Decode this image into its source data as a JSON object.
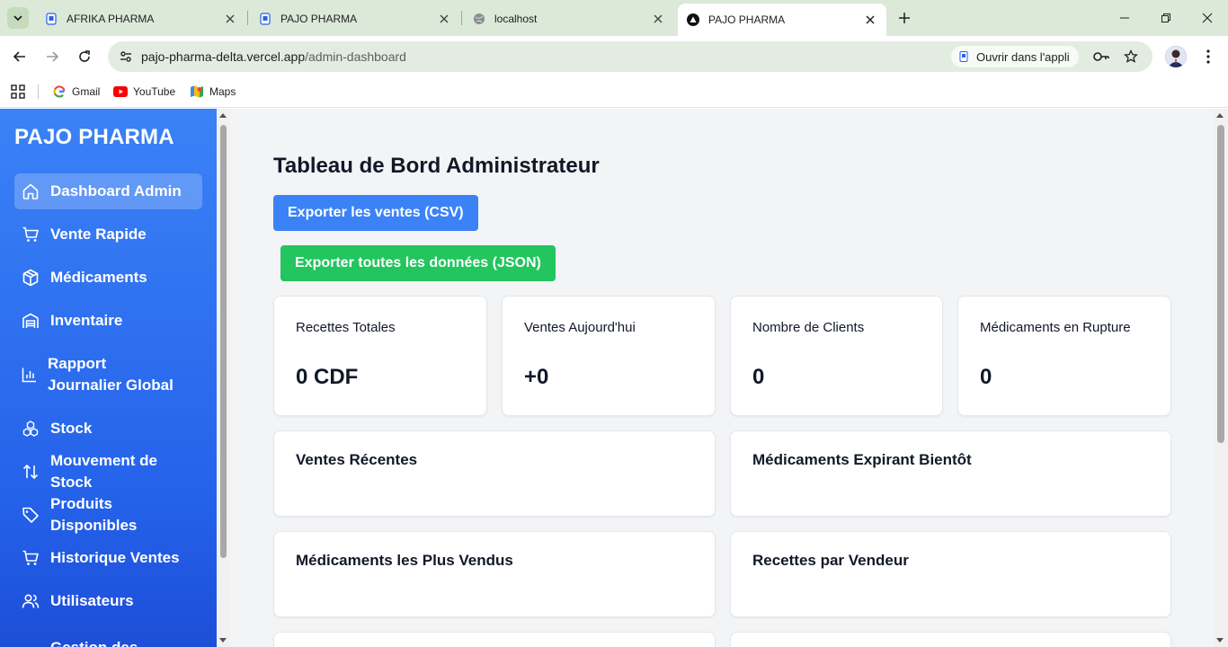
{
  "browser": {
    "tabs": [
      {
        "title": "AFRIKA PHARMA",
        "active": false
      },
      {
        "title": "PAJO PHARMA",
        "active": false
      },
      {
        "title": "localhost",
        "active": false
      },
      {
        "title": "PAJO PHARMA",
        "active": true
      }
    ],
    "url_host": "pajo-pharma-delta.vercel.app",
    "url_path": "/admin-dashboard",
    "open_in_app": "Ouvrir dans l'appli",
    "bookmarks": [
      "Gmail",
      "YouTube",
      "Maps"
    ]
  },
  "sidebar": {
    "brand": "PAJO PHARMA",
    "items": [
      {
        "label": "Dashboard Admin",
        "icon": "home-icon",
        "active": true
      },
      {
        "label": "Vente Rapide",
        "icon": "cart-icon"
      },
      {
        "label": "Médicaments",
        "icon": "package-icon"
      },
      {
        "label": "Inventaire",
        "icon": "warehouse-icon"
      },
      {
        "label": "Rapport Journalier Global",
        "icon": "bar-chart-icon"
      },
      {
        "label": "Stock",
        "icon": "boxes-icon"
      },
      {
        "label": "Mouvement de Stock",
        "icon": "arrows-up-down-icon"
      },
      {
        "label": "Produits Disponibles",
        "icon": "tag-icon"
      },
      {
        "label": "Historique Ventes",
        "icon": "cart-icon"
      },
      {
        "label": "Utilisateurs",
        "icon": "users-icon"
      },
      {
        "label": "Gestion des",
        "icon": "settings-icon"
      }
    ]
  },
  "main": {
    "title": "Tableau de Bord Administrateur",
    "export_csv": "Exporter les ventes (CSV)",
    "export_json": "Exporter toutes les données (JSON)",
    "stats": [
      {
        "label": "Recettes Totales",
        "value": "0 CDF"
      },
      {
        "label": "Ventes Aujourd'hui",
        "value": "+0"
      },
      {
        "label": "Nombre de Clients",
        "value": "0"
      },
      {
        "label": "Médicaments en Rupture",
        "value": "0"
      }
    ],
    "panels": [
      {
        "title": "Ventes Récentes"
      },
      {
        "title": "Médicaments Expirant Bientôt"
      },
      {
        "title": "Médicaments les Plus Vendus"
      },
      {
        "title": "Recettes par Vendeur"
      }
    ]
  },
  "colors": {
    "sidebar": "#2563eb",
    "primary_button": "#3b82f6",
    "success_button": "#22c55e",
    "page_bg": "#f3f4f6"
  }
}
